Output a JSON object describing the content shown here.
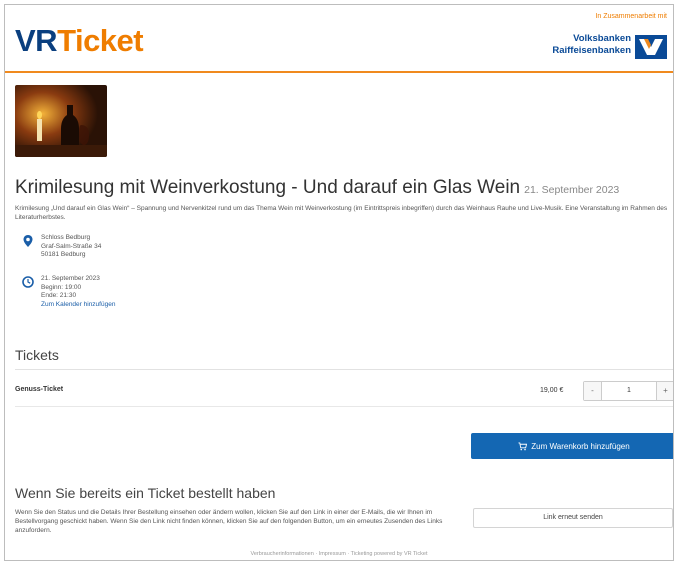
{
  "header": {
    "brand_vr": "VR",
    "brand_ticket": "Ticket",
    "partner_note": "In Zusammenarbeit mit",
    "bank_line1": "Volksbanken",
    "bank_line2": "Raiffeisenbanken"
  },
  "event": {
    "title": "Krimilesung mit Weinverkostung - Und darauf ein Glas Wein",
    "date": "21. September 2023",
    "description": "Krimilesung „Und darauf ein Glas Wein“ – Spannung und Nervenkitzel rund um das Thema Wein mit Weinverkostung (im Eintrittspreis inbegriffen) durch das Weinhaus Rauhe und Live-Musik. Eine Veranstaltung im Rahmen des Literaturherbstes.",
    "location": {
      "name": "Schloss Bedburg",
      "street": "Graf-Salm-Straße 34",
      "city": "50181 Bedburg"
    },
    "time": {
      "date": "21. September 2023",
      "begin": "Beginn: 19:00",
      "end": "Ende: 21:30",
      "calendar_link": "Zum Kalender hinzufügen"
    }
  },
  "tickets": {
    "heading": "Tickets",
    "items": [
      {
        "name": "Genuss-Ticket",
        "price": "19,00 €",
        "quantity": "1"
      }
    ],
    "minus": "-",
    "plus": "+",
    "cart_button": "Zum Warenkorb hinzufügen"
  },
  "already_ordered": {
    "heading": "Wenn Sie bereits ein Ticket bestellt haben",
    "text": "Wenn Sie den Status und die Details Ihrer Bestellung einsehen oder ändern wollen, klicken Sie auf den Link in einer der E-Mails, die wir Ihnen im Bestellvorgang geschickt haben. Wenn Sie den Link nicht finden können, klicken Sie auf den folgenden Button, um ein erneutes Zusenden des Links anzufordern.",
    "resend_button": "Link erneut senden"
  },
  "footer": {
    "text": "Verbraucherinformationen · Impressum · Ticketing powered by VR Ticket"
  },
  "colors": {
    "brand_blue": "#0a3f7f",
    "brand_orange": "#ef7d00",
    "button_blue": "#1467b3",
    "icon_blue": "#1a5ea8"
  }
}
